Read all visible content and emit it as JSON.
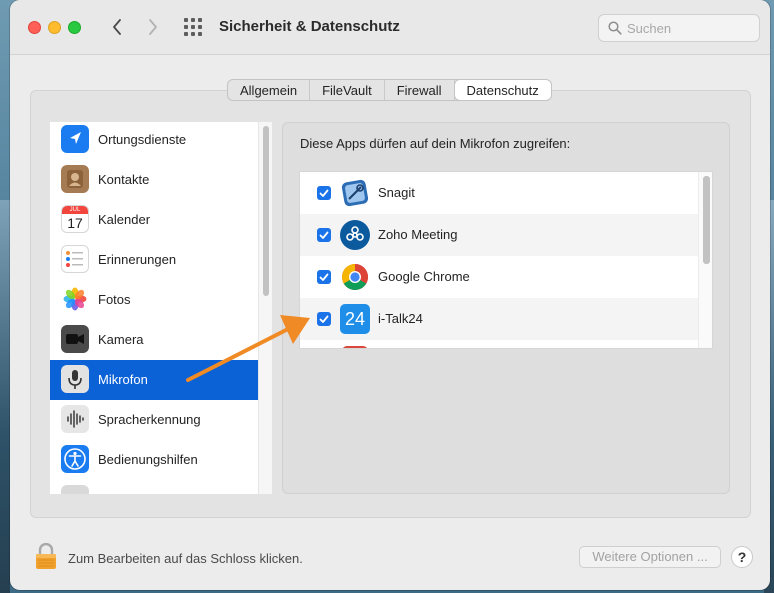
{
  "window": {
    "title": "Sicherheit & Datenschutz"
  },
  "search": {
    "placeholder": "Suchen",
    "value": ""
  },
  "tabs": [
    {
      "label": "Allgemein",
      "active": false
    },
    {
      "label": "FileVault",
      "active": false
    },
    {
      "label": "Firewall",
      "active": false
    },
    {
      "label": "Datenschutz",
      "active": true
    }
  ],
  "sidebar": {
    "items": [
      {
        "label": "Ortungsdienste",
        "icon": "location-arrow-icon",
        "color": "#1a7cf0"
      },
      {
        "label": "Kontakte",
        "icon": "contacts-icon",
        "color": "#a47b52"
      },
      {
        "label": "Kalender",
        "icon": "calendar-icon",
        "color": "#ffffff",
        "calendar_month": "JUL",
        "calendar_day": "17"
      },
      {
        "label": "Erinnerungen",
        "icon": "reminders-icon",
        "color": "#ffffff"
      },
      {
        "label": "Fotos",
        "icon": "photos-icon",
        "color": "#ffffff"
      },
      {
        "label": "Kamera",
        "icon": "camera-icon",
        "color": "#4a4a4a"
      },
      {
        "label": "Mikrofon",
        "icon": "microphone-icon",
        "color": "#5a5a5a",
        "selected": true
      },
      {
        "label": "Spracherkennung",
        "icon": "speech-waveform-icon",
        "color": "#5a5a5a"
      },
      {
        "label": "Bedienungshilfen",
        "icon": "accessibility-icon",
        "color": "#1a7cf0"
      }
    ]
  },
  "panel": {
    "heading": "Diese Apps dürfen auf dein Mikrofon zugreifen:",
    "apps": [
      {
        "label": "Snagit",
        "checked": true,
        "icon": "snagit-icon"
      },
      {
        "label": "Zoho Meeting",
        "checked": true,
        "icon": "zoho-meeting-icon"
      },
      {
        "label": "Google Chrome",
        "checked": true,
        "icon": "chrome-icon"
      },
      {
        "label": "i-Talk24",
        "checked": true,
        "icon": "italk24-icon",
        "icon_text": "24"
      }
    ]
  },
  "footer": {
    "lock_text": "Zum Bearbeiten auf das Schloss klicken.",
    "more_options_label": "Weitere Optionen ...",
    "help_label": "?"
  },
  "colors": {
    "accent": "#0b62d6",
    "checkbox": "#1a73e8",
    "annotation_arrow": "#f08a24"
  }
}
